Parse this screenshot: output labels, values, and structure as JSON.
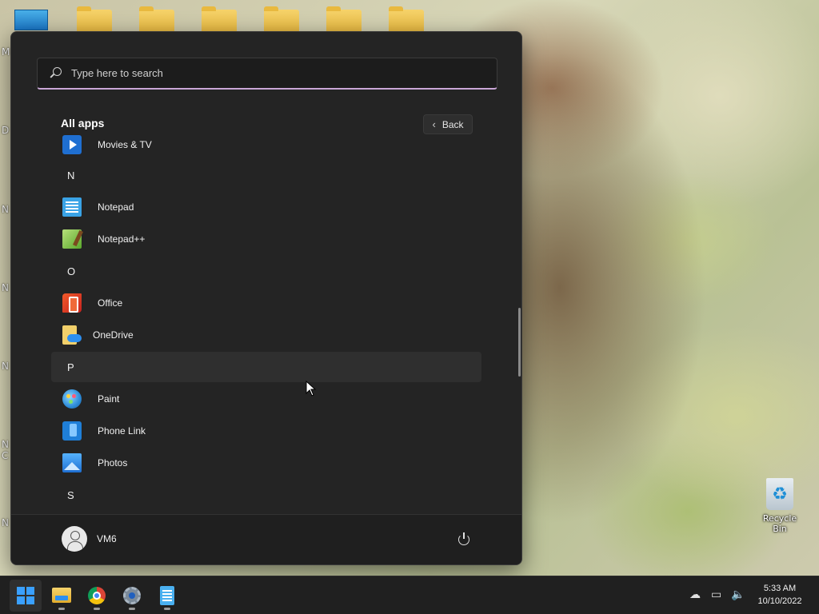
{
  "desktop": {
    "left_clipped_letters": [
      "M",
      "D",
      "N",
      "N",
      "N",
      "N",
      "C",
      "N"
    ],
    "recycle_bin_label": "Recycle Bin"
  },
  "start_menu": {
    "search_placeholder": "Type here to search",
    "all_apps_title": "All apps",
    "back_label": "Back",
    "items": [
      {
        "type": "app",
        "label": "Movies & TV",
        "icon": "movies-tv-icon"
      },
      {
        "type": "letter",
        "label": "N"
      },
      {
        "type": "app",
        "label": "Notepad",
        "icon": "notepad-icon"
      },
      {
        "type": "app",
        "label": "Notepad++",
        "icon": "notepad-plus-plus-icon"
      },
      {
        "type": "letter",
        "label": "O"
      },
      {
        "type": "app",
        "label": "Office",
        "icon": "office-icon"
      },
      {
        "type": "app",
        "label": "OneDrive",
        "icon": "onedrive-icon"
      },
      {
        "type": "letter",
        "label": "P"
      },
      {
        "type": "app",
        "label": "Paint",
        "icon": "paint-icon"
      },
      {
        "type": "app",
        "label": "Phone Link",
        "icon": "phone-link-icon"
      },
      {
        "type": "app",
        "label": "Photos",
        "icon": "photos-icon"
      },
      {
        "type": "letter",
        "label": "S"
      }
    ],
    "user_name": "VM6"
  },
  "taskbar": {
    "apps": [
      "start-icon",
      "file-explorer-icon",
      "chrome-icon",
      "settings-icon",
      "notepad-icon"
    ],
    "tray": [
      "cloud-offline-icon",
      "network-icon",
      "volume-icon"
    ],
    "time": "5:33 AM",
    "date": "10/10/2022"
  }
}
